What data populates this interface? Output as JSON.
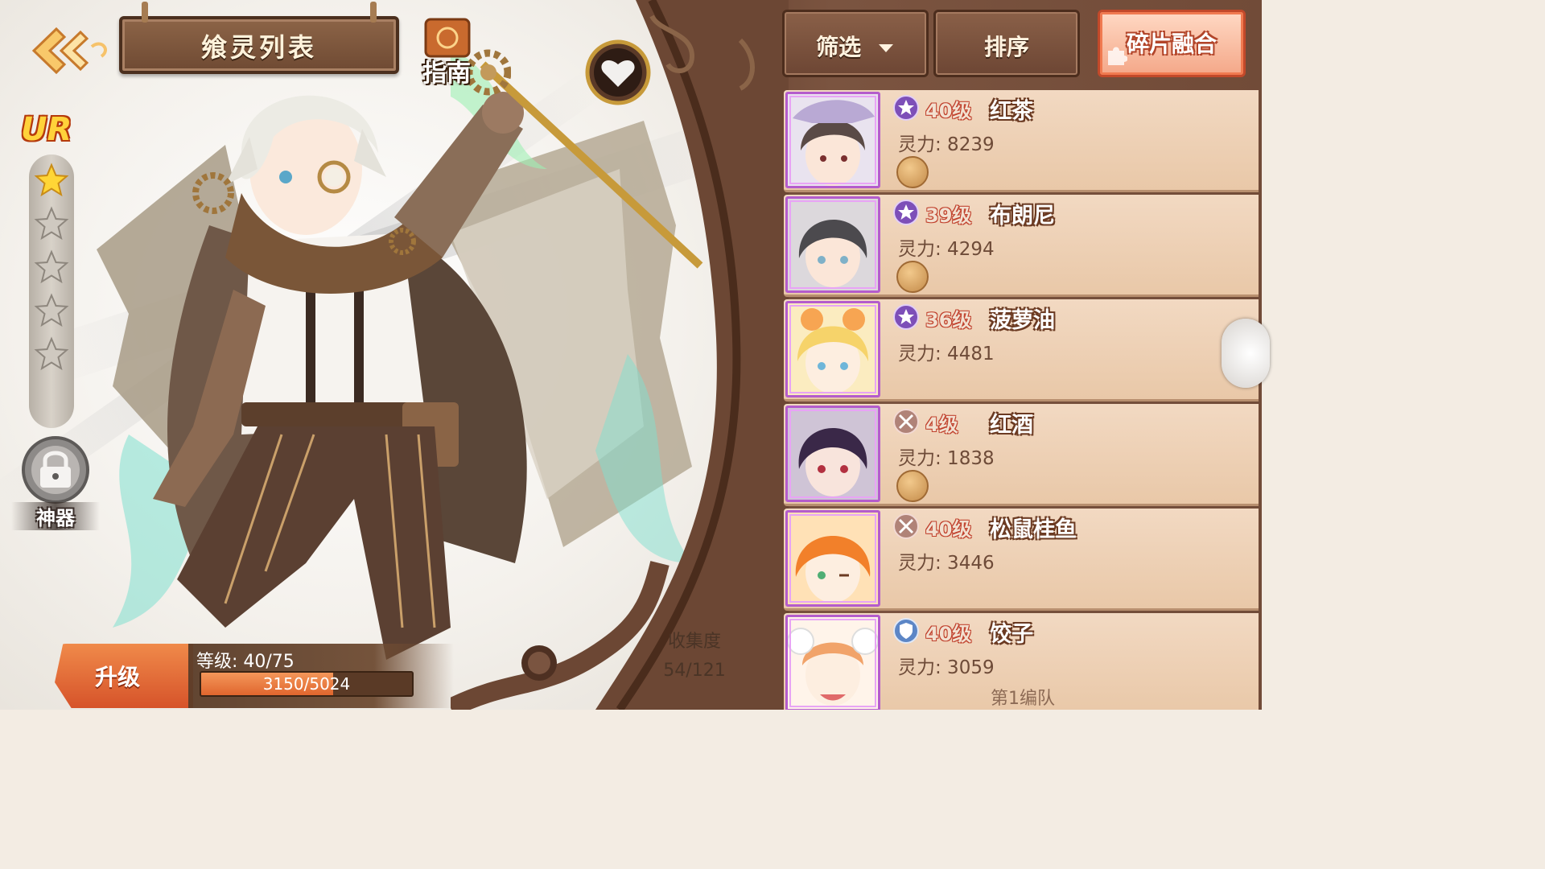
{
  "header": {
    "title": "飨灵列表",
    "guide_label": "指南"
  },
  "character": {
    "rarity": "UR",
    "stars_filled": 1,
    "stars_total": 5,
    "artifact_label": "神器"
  },
  "bottom": {
    "upgrade_label": "升级",
    "level_text": "等级: 40/75",
    "exp_text": "3150/5024",
    "exp_current": 3150,
    "exp_max": 5024,
    "collection_label": "收集度",
    "collection_value": "54/121"
  },
  "toolbar": {
    "filter_label": "筛选",
    "sort_label": "排序",
    "fuse_label": "碎片融合"
  },
  "list": {
    "items": [
      {
        "level": "40级",
        "name": "红茶",
        "power": "灵力: 8239",
        "type_icon": "star-emblem-icon",
        "has_coin": true,
        "hair": "#5a4a46",
        "bg": "#e9e3ef"
      },
      {
        "level": "39级",
        "name": "布朗尼",
        "power": "灵力: 4294",
        "type_icon": "star-emblem-icon",
        "has_coin": true,
        "hair": "#4c4a4e",
        "bg": "#dcd8dc"
      },
      {
        "level": "36级",
        "name": "菠萝油",
        "power": "灵力: 4481",
        "type_icon": "star-emblem-icon",
        "has_coin": false,
        "hair": "#f6d36a",
        "bg": "#fbecc0"
      },
      {
        "level": "4级",
        "name": "红酒",
        "power": "灵力: 1838",
        "type_icon": "crossed-swords-icon",
        "has_coin": true,
        "hair": "#3a2848",
        "bg": "#cfc4d6"
      },
      {
        "level": "40级",
        "name": "松鼠桂鱼",
        "power": "灵力: 3446",
        "type_icon": "crossed-swords-icon",
        "has_coin": false,
        "hair": "#f2802a",
        "bg": "#ffe1b6"
      },
      {
        "level": "40级",
        "name": "饺子",
        "power": "灵力: 3059",
        "type_icon": "shield-icon",
        "has_coin": false,
        "hair": "#f1a36a",
        "bg": "#fff4ea"
      }
    ],
    "team_tag": "第1编队"
  },
  "colors": {
    "accent_orange": "#e0662e",
    "wood_dark": "#4c2d1d",
    "wood_mid": "#7b5440",
    "card_bg": "#eed2b8",
    "portrait_border": "#b45ccc",
    "level_red": "#c0402c"
  }
}
